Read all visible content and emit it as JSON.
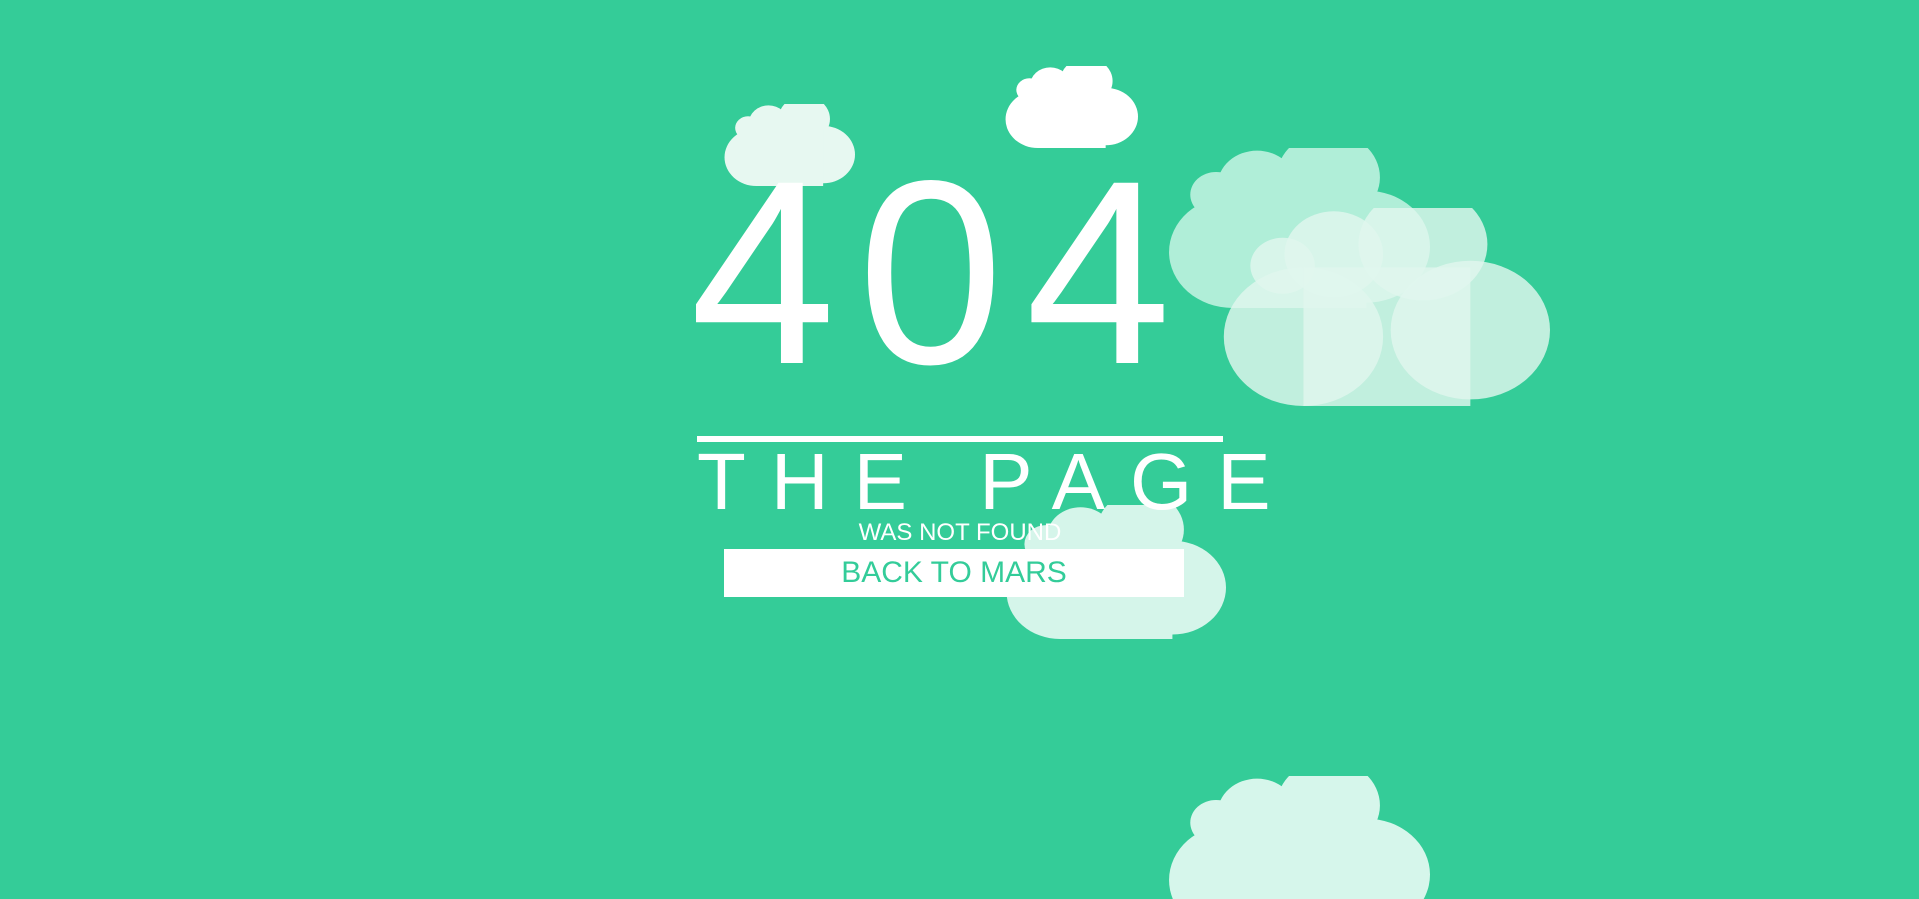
{
  "error": {
    "code": "404",
    "headline": "THE PAGE",
    "subline": "WAS NOT FOUND"
  },
  "actions": {
    "back_label": "BACK TO MARS"
  },
  "colors": {
    "background": "#34cc98",
    "text": "#ffffff",
    "button_background": "#ffffff",
    "button_text": "#33cc99"
  },
  "decorations": [
    "cloud",
    "cloud",
    "cloud",
    "cloud",
    "cloud",
    "cloud"
  ]
}
